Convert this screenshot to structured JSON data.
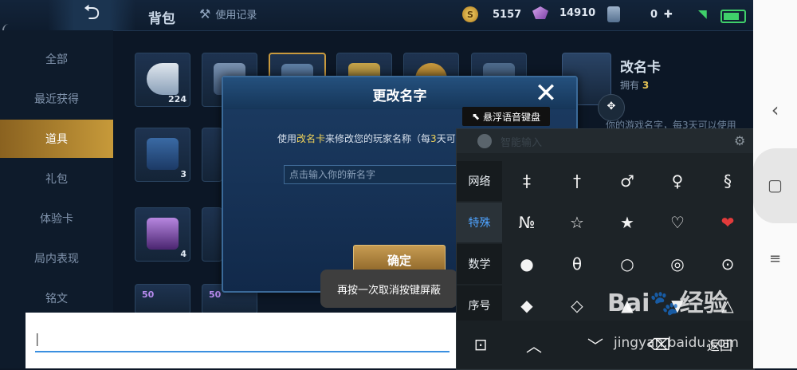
{
  "header": {
    "back_icon": "back-arrow-icon",
    "title": "背包",
    "history_label": "使用记录",
    "gold": "5157",
    "diamonds": "14910",
    "cards": "0",
    "plus": "✚"
  },
  "sidebar": {
    "items": [
      "全部",
      "最近获得",
      "道具",
      "礼包",
      "体验卡",
      "局内表现",
      "铭文"
    ],
    "active_index": 2
  },
  "grid": {
    "counts": [
      "224",
      "3",
      "4"
    ],
    "badges": [
      "50",
      "50"
    ]
  },
  "detail": {
    "name": "改名卡",
    "own_prefix": "拥有",
    "own_count": "3",
    "desc": "你的游戏名字，每3天可以使用"
  },
  "dialog": {
    "title": "更改名字",
    "close": "✕",
    "msg_prefix": "使用",
    "msg_highlight": "改名卡",
    "msg_middle": "来修改您的玩家名称（每",
    "msg_num": "3",
    "msg_suffix": "天可",
    "input_placeholder": "点击输入你的新名字",
    "confirm_label": "确定"
  },
  "toast": {
    "text": "再按一次取消按键屏蔽"
  },
  "floating": {
    "voice_label": "悬浮语音键盘",
    "move_handle": "✥"
  },
  "keyboard": {
    "brand": "智能输入",
    "categories": [
      "网络",
      "特殊",
      "数学",
      "序号"
    ],
    "active_category": 1,
    "symbols": [
      [
        "‡",
        "†",
        "♂",
        "♀",
        "§"
      ],
      [
        "№",
        "☆",
        "★",
        "♡",
        "❤"
      ],
      [
        "●",
        "θ",
        "○",
        "◎",
        "⊙"
      ],
      [
        "◆",
        "◇",
        "▲",
        "▼",
        "△"
      ]
    ],
    "bottom": {
      "lock": "⊡",
      "up": "︿",
      "down": "﹀",
      "delete": "⌫",
      "back_label": "返回"
    }
  },
  "input_bar": {
    "value": "|"
  },
  "nav": {
    "back": "‹",
    "home": "▢",
    "menu": "≡"
  },
  "watermark": {
    "line1": "Bai",
    "line1b": "经验",
    "line2": "jingyan.baidu.com"
  }
}
